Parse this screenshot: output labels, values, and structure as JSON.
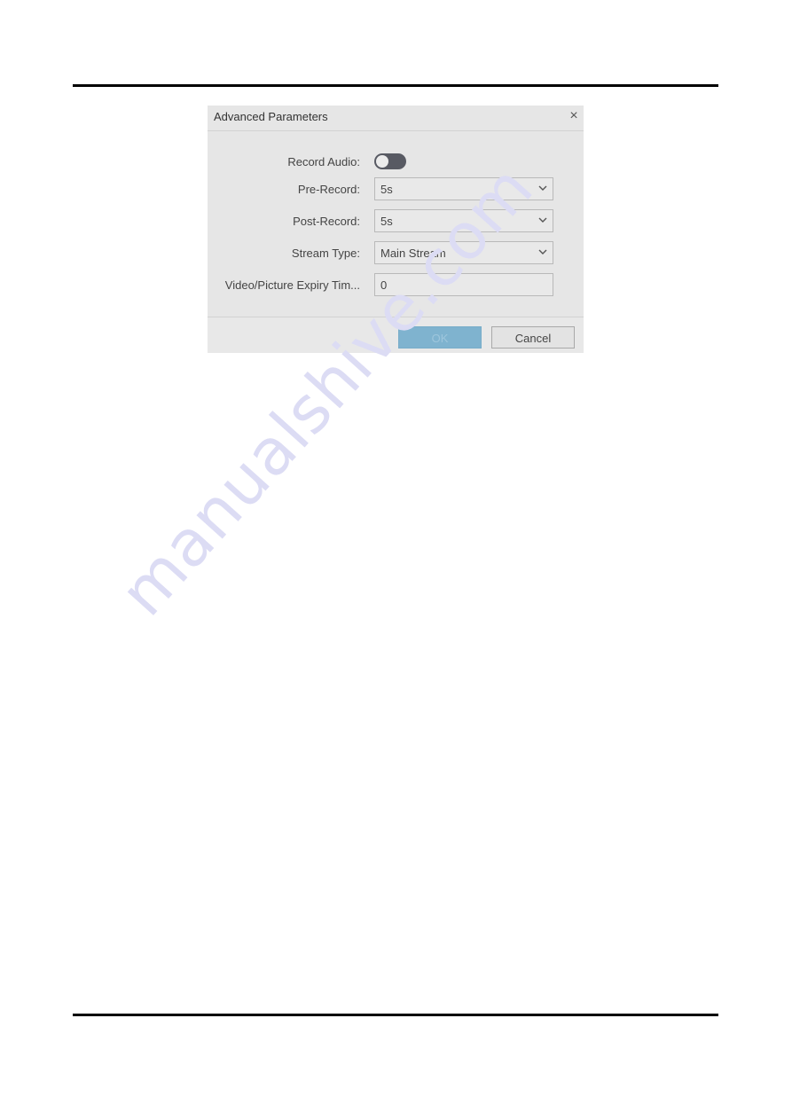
{
  "dialog": {
    "title": "Advanced Parameters",
    "close_icon": "close-icon",
    "fields": {
      "record_audio": {
        "label": "Record Audio:",
        "enabled": false
      },
      "pre_record": {
        "label": "Pre-Record:",
        "value": "5s"
      },
      "post_record": {
        "label": "Post-Record:",
        "value": "5s"
      },
      "stream_type": {
        "label": "Stream Type:",
        "value": "Main Stream"
      },
      "expiry_time": {
        "label": "Video/Picture Expiry Tim...",
        "value": "0"
      }
    },
    "buttons": {
      "ok": "OK",
      "cancel": "Cancel"
    },
    "colors": {
      "ok_button": "#7fb3cf",
      "toggle_off": "#585a63"
    }
  },
  "watermark": "manualshive.com"
}
